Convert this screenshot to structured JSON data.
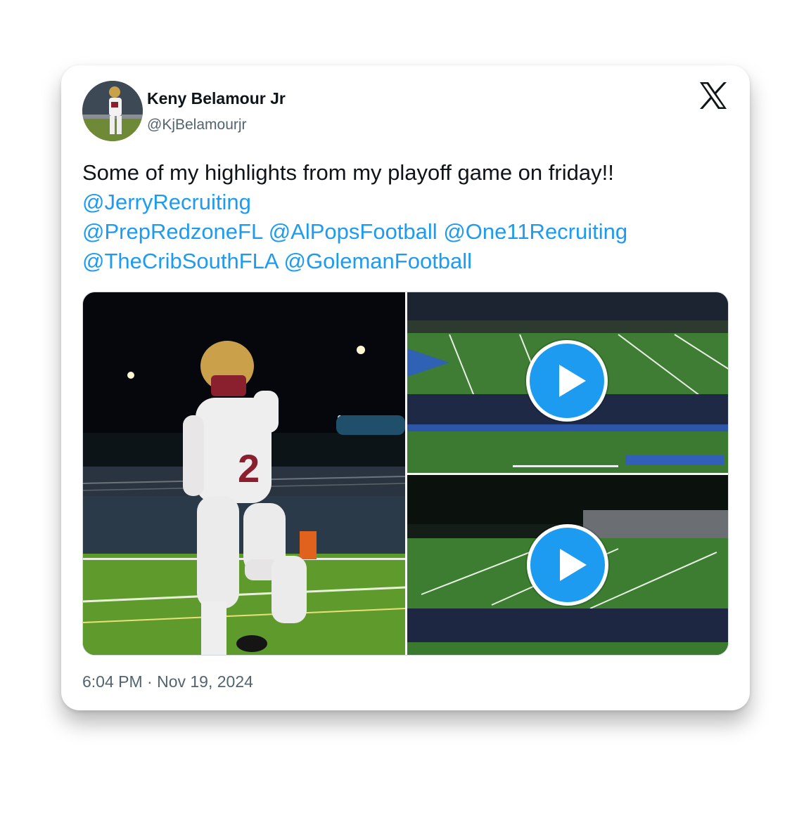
{
  "author": {
    "display_name": "Keny Belamour Jr",
    "handle": "@KjBelamourjr"
  },
  "tweet": {
    "text_line1": "Some of my highlights from my playoff game on friday!!",
    "mentions": [
      "@JerryRecruiting",
      "@PrepRedzoneFL",
      "@AlPopsFootball",
      "@One11Recruiting",
      "@TheCribSouthFLA",
      "@GolemanFootball"
    ],
    "spacer": " "
  },
  "media": {
    "photo_icon": "football-player-photo",
    "video_icon": "play-icon",
    "colors": {
      "accent": "#1d9bf0",
      "field": "#2f6b2a",
      "jersey_red": "#8a1f2d",
      "helmet_gold": "#c8a24a"
    }
  },
  "timestamp": "6:04 PM · Nov 19, 2024",
  "brand_icon": "x-logo-icon"
}
